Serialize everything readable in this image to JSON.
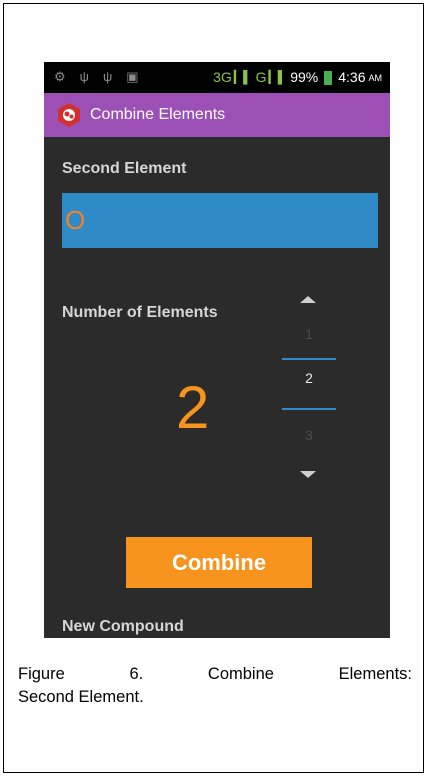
{
  "status_bar": {
    "network_3g": "3G",
    "network_g": "G",
    "battery_percent": "99%",
    "time": "4:36",
    "ampm": "AM",
    "left_icons": [
      "usb-debug-icon",
      "usb-icon",
      "usb-icon",
      "image-icon"
    ]
  },
  "action_bar": {
    "title": "Combine Elements",
    "color": "#9c50b6"
  },
  "second_element": {
    "label": "Second Element",
    "value": "O"
  },
  "number_of_elements": {
    "label": "Number of Elements",
    "value": "2",
    "picker": {
      "previous": "1",
      "current": "2",
      "next": "3"
    }
  },
  "combine_button": {
    "label": "Combine"
  },
  "new_compound_label": "New Compound",
  "caption": {
    "line1": "Figure 6. Combine Elements:",
    "line2": "Second Element."
  },
  "colors": {
    "accent_orange": "#f7941d",
    "field_blue": "#2e8bc8",
    "background": "#2b2b2b"
  }
}
